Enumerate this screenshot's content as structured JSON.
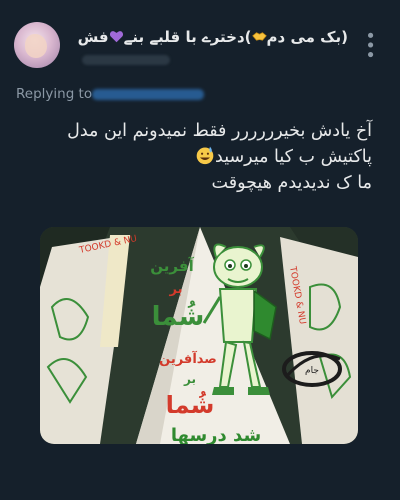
{
  "tweet": {
    "display_name": "(بک می دم",
    "display_name_suffix": ")دخترے با قلبے بنے",
    "display_name_end": "فش",
    "replying_to_label": "Replying to",
    "text_lines": [
      "آخ یادش بخیرررررر فقط نمیدونم این مدل",
      "پاکتیش ب کیا میرسید",
      "ما ک ندیدیدم هیچوقت"
    ],
    "more_icon": "more-vertical-icon"
  },
  "media": {
    "image_text": {
      "afarin_top": "آفرین",
      "bar_top": "بر",
      "shoma_top": "شُما",
      "sad_afarin": "صدآفرین",
      "bar_bottom": "بر",
      "shoma_bottom": "شُما",
      "bottom_banner": "شد درسها",
      "side_strip": "TOOKD & NU",
      "logo": "جام"
    },
    "colors": {
      "background_foliage": "#2c3a2e",
      "paper_cone": "#eeeae0",
      "green_ink": "#3b8f3a",
      "red_ink": "#d33a2b"
    }
  }
}
